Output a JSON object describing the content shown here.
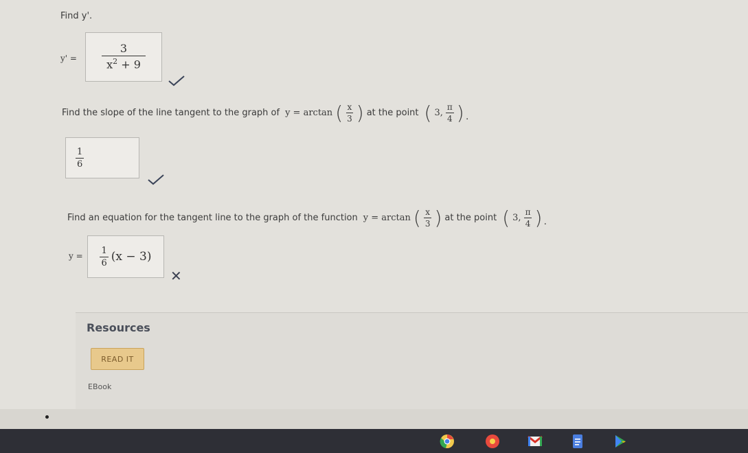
{
  "q1": {
    "prompt": "Find y'.",
    "label": "y' =",
    "answer_num": "3",
    "answer_den_base": "x",
    "answer_den_exp": "2",
    "answer_den_rest": " + 9"
  },
  "q2": {
    "prompt_before": "Find the slope of the line tangent to the graph of",
    "func_lhs": "y = arctan",
    "func_num": "x",
    "func_den": "3",
    "at_text": "at the point",
    "point_x": "3,",
    "point_num": "π",
    "point_den": "4",
    "point_end": ").",
    "answer_num": "1",
    "answer_den": "6"
  },
  "q3": {
    "prompt_before": "Find an equation for the tangent line to the graph of the function",
    "func_lhs": "y = arctan",
    "func_num": "x",
    "func_den": "3",
    "at_text": "at the point",
    "point_x": "3,",
    "point_num": "π",
    "point_den": "4",
    "point_end": ").",
    "label": "y =",
    "answer_num": "1",
    "answer_den": "6",
    "answer_rest": "(x − 3)"
  },
  "resources": {
    "title": "Resources",
    "read_button": "READ IT",
    "ebook": "EBook"
  },
  "taskbar_icons": [
    "chrome-icon",
    "app-icon",
    "gmail-icon",
    "docs-icon",
    "play-icon"
  ],
  "colors": {
    "check": "#3a4358",
    "read_button_bg": "#e8c98c",
    "taskbar": "#2e2f36"
  }
}
